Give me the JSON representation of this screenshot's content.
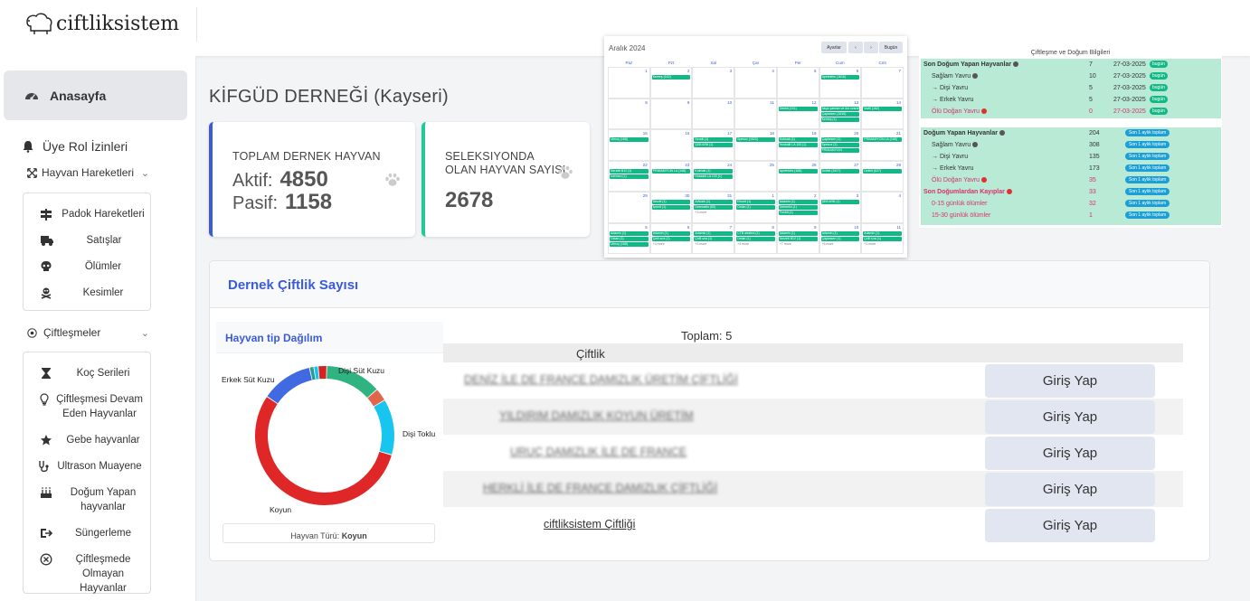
{
  "brand": {
    "name": "ciftliksistem"
  },
  "sidebar": {
    "home": "Anasayfa",
    "roles": "Üye Rol İzinleri",
    "animal_moves": {
      "label": "Hayvan Hareketleri",
      "items": [
        "Padok Hareketleri",
        "Satışlar",
        "Ölümler",
        "Kesimler"
      ]
    },
    "matings": {
      "label": "Çiftleşmeler",
      "items": [
        "Koç Serileri",
        "Çiftleşmesi Devam Eden Hayvanlar",
        "Gebe hayvanlar",
        "Ultrason Muayene",
        "Doğum Yapan hayvanlar",
        "Süngerleme",
        "Çiftleşmede Olmayan Hayvanlar"
      ]
    }
  },
  "page": {
    "title": "KİFGÜD DERNEĞİ (Kayseri)"
  },
  "cards": {
    "total": {
      "label": "TOPLAM DERNEK HAYVAN",
      "active_label": "Aktif:",
      "active": "4850",
      "passive_label": "Pasif:",
      "passive": "1158"
    },
    "selection": {
      "label": "SELEKSIYONDA OLAN HAYVAN SAYISI",
      "value": "2678"
    }
  },
  "calendar": {
    "title": "Aralık 2024",
    "settings": "Ayarlar",
    "prev": "‹",
    "next": "›",
    "today": "Bugün",
    "days": [
      "Paz",
      "Pzt",
      "Sal",
      "Çar",
      "Per",
      "Cum",
      "Cmt"
    ],
    "weeks": [
      [
        "1",
        "2",
        "3",
        "4",
        "5",
        "6",
        "7"
      ],
      [
        "8",
        "9",
        "10",
        "11",
        "12",
        "13",
        "14"
      ],
      [
        "15",
        "16",
        "17",
        "18",
        "19",
        "20",
        "21"
      ],
      [
        "22",
        "23",
        "24",
        "25",
        "26",
        "27",
        "28"
      ],
      [
        "29",
        "30",
        "31",
        "1",
        "2",
        "3",
        "4"
      ],
      [
        "5",
        "6",
        "7",
        "8",
        "9",
        "10",
        "11"
      ]
    ],
    "events": [
      {
        "w": 0,
        "d": 1,
        "t": [
          "Kemeş (162)"
        ]
      },
      {
        "w": 0,
        "d": 5,
        "t": [
          "Apetekiris (1616)"
        ]
      },
      {
        "w": 1,
        "d": 4,
        "t": [
          "Delibit (151)"
        ]
      },
      {
        "w": 1,
        "d": 5,
        "t": [
          "Akça yamlan ve üst ovaran",
          "Çapkesen (1616)",
          "Kemeş (1)"
        ]
      },
      {
        "w": 1,
        "d": 6,
        "t": [
          "Mafit (162)"
        ]
      },
      {
        "w": 2,
        "d": 0,
        "t": [
          "Ulmuş (168)"
        ]
      },
      {
        "w": 2,
        "d": 2,
        "t": [
          "Serzili (1)",
          "ŞEB 6/96 (1)"
        ]
      },
      {
        "w": 2,
        "d": 3,
        "t": [
          "Spesoz (1523)"
        ]
      },
      {
        "w": 2,
        "d": 4,
        "t": [
          "Kutmak (1)",
          "Hoskalit LA 100 (1)"
        ]
      },
      {
        "w": 2,
        "d": 5,
        "t": [
          "Çapkesen (1)",
          "Spesoz (1)",
          "PRIMAMYCIN"
        ]
      },
      {
        "w": 2,
        "d": 6,
        "t": [
          "PRIMAMYCIN LA (168)"
        ]
      },
      {
        "w": 3,
        "d": 0,
        "t": [
          "Serzeti B12 (1)",
          "Ivermec (1)"
        ]
      },
      {
        "w": 3,
        "d": 1,
        "t": [
          "PRIMAMYCIN LA (168)"
        ]
      },
      {
        "w": 3,
        "d": 2,
        "t": [
          "Kutmak (1)",
          "Hoskalit LA 100 (1)"
        ]
      },
      {
        "w": 3,
        "d": 4,
        "t": [
          "Apetekiris (168)"
        ]
      },
      {
        "w": 3,
        "d": 5,
        "t": [
          "Delibit (1627)"
        ]
      },
      {
        "w": 3,
        "d": 6,
        "t": [
          "Delibit (627)"
        ]
      },
      {
        "w": 4,
        "d": 1,
        "t": [
          "Serzili (1)",
          "Ivomit (1)"
        ]
      },
      {
        "w": 4,
        "d": 2,
        "t": [
          "Arflozik (1)",
          "Delmostin (60)"
        ]
      },
      {
        "w": 4,
        "d": 3,
        "t": [
          "Efcorit (1)",
          "Oxtan (1)"
        ]
      },
      {
        "w": 4,
        "d": 4,
        "t": [
          "Adamin (1)",
          "Delmetin (1)",
          "Fenbit (1)"
        ]
      },
      {
        "w": 4,
        "d": 5,
        "t": [
          "ŞEB 6/96 (1)"
        ]
      },
      {
        "w": 5,
        "d": 0,
        "t": [
          "Adamin (1)",
          "Oxtan (1)",
          "Ulmuş (168)"
        ]
      },
      {
        "w": 5,
        "d": 1,
        "t": [
          "Adamin (1)",
          "Çelli sıra (1)"
        ]
      },
      {
        "w": 5,
        "d": 2,
        "t": [
          "Adamin (1)",
          "Çelli sıra (1)"
        ]
      },
      {
        "w": 5,
        "d": 3,
        "t": [
          "CTB alsekra (1)",
          "Oxtan (1)"
        ]
      },
      {
        "w": 5,
        "d": 4,
        "t": [
          "Adamin (1)",
          "Serzeti B12 (1)"
        ]
      },
      {
        "w": 5,
        "d": 5,
        "t": [
          "Adamin (1)",
          "Çapkesen (1)"
        ]
      },
      {
        "w": 5,
        "d": 6,
        "t": [
          "Adamin (1)",
          "Çelli sıra (1)"
        ]
      }
    ],
    "more": [
      {
        "w": 4,
        "d": 2,
        "t": "+3 more"
      },
      {
        "w": 5,
        "d": 1,
        "t": "+4 more"
      },
      {
        "w": 5,
        "d": 2,
        "t": "+3 more"
      },
      {
        "w": 5,
        "d": 3,
        "t": "+3 more"
      },
      {
        "w": 5,
        "d": 4,
        "t": "+7 more"
      },
      {
        "w": 5,
        "d": 5,
        "t": "+6 more"
      },
      {
        "w": 5,
        "d": 6,
        "t": "+3 more"
      }
    ]
  },
  "breeding": {
    "title": "Çiftleşme ve Doğum Bilgileri",
    "last_birth": {
      "rows": [
        {
          "k": "Son Doğum Yapan Hayvanlar",
          "v": "7",
          "d": "27-03-2025",
          "p": "bugün",
          "style": "bold",
          "dot": "dk"
        },
        {
          "k": "Sağlam Yavru",
          "v": "10",
          "d": "27-03-2025",
          "p": "bugün",
          "dot": "dk"
        },
        {
          "k": "→ Dişi Yavru",
          "v": "5",
          "d": "27-03-2025",
          "p": "bugün"
        },
        {
          "k": "→ Erkek Yavru",
          "v": "5",
          "d": "27-03-2025",
          "p": "bugün"
        },
        {
          "k": "Ölü Doğan Yavru",
          "v": "0",
          "d": "27-03-2025",
          "p": "bugün",
          "style": "red",
          "dot": "red"
        }
      ]
    },
    "monthly": {
      "rows": [
        {
          "k": "Doğum Yapan Hayvanlar",
          "v": "204",
          "p": "Son 1 aylık toplam",
          "style": "bold",
          "dot": "dk"
        },
        {
          "k": "Sağlam Yavru",
          "v": "308",
          "p": "Son 1 aylık toplam",
          "dot": "dk"
        },
        {
          "k": "→ Dişi Yavru",
          "v": "135",
          "p": "Son 1 aylık toplam"
        },
        {
          "k": "→ Erkek Yavru",
          "v": "173",
          "p": "Son 1 aylık toplam"
        },
        {
          "k": "Ölü Doğan Yavru",
          "v": "35",
          "p": "Son 1 aylık toplam",
          "style": "red",
          "dot": "red"
        },
        {
          "k": "Son Doğumlardan Kayıplar",
          "v": "33",
          "p": "Son 1 aylık toplam",
          "style": "redbold",
          "dot": "red"
        },
        {
          "k": "0-15 günlük ölümler",
          "v": "32",
          "p": "Son 1 aylık toplam",
          "style": "red"
        },
        {
          "k": "15-30 günlük ölümler",
          "v": "1",
          "p": "Son 1 aylık toplam",
          "style": "red"
        }
      ]
    }
  },
  "panel": {
    "title": "Dernek Çiftlik Sayısı",
    "total": "Toplam: 5",
    "column": "Çiftlik",
    "login": "Giriş Yap",
    "farms": [
      "DENİZ İLE DE FRANCE DAMIZLIK ÜRETİM ÇİFTLİĞİ",
      "YILDIRIM DAMIZLIK KOYUN ÜRETİM",
      "URUÇ DAMIZLIK İLE DE FRANCE",
      "HERKLİ İLE DE FRANCE DAMIZLIK ÇİFTLİĞİ",
      "ciftliksistem Çiftliği"
    ]
  },
  "pie": {
    "title": "Hayvan tip Dağılım",
    "footer_label": "Hayvan Türü:",
    "footer_value": "Koyun"
  },
  "chart_data": {
    "type": "pie",
    "title": "Hayvan tip Dağılım",
    "series": [
      {
        "name": "Dişi Süt Kuzu",
        "value": 13,
        "color": "#2fb380"
      },
      {
        "name": "(unlabeled)",
        "value": 3,
        "color": "#e0664b"
      },
      {
        "name": "Dişi Toklu",
        "value": 13,
        "color": "#17c5ee"
      },
      {
        "name": "Koyun",
        "value": 55,
        "color": "#e02727"
      },
      {
        "name": "Erkek Süt Kuzu",
        "value": 12,
        "color": "#4169e1"
      },
      {
        "name": "(unlabeled)",
        "value": 1,
        "color": "#2a9d8f"
      },
      {
        "name": "(unlabeled)",
        "value": 1,
        "color": "#17c5ee"
      },
      {
        "name": "(unlabeled)",
        "value": 2,
        "color": "#d62222"
      }
    ],
    "labels": [
      "Dişi Süt Kuzu",
      "Dişi Toklu",
      "Koyun",
      "Erkek Süt Kuzu"
    ]
  }
}
